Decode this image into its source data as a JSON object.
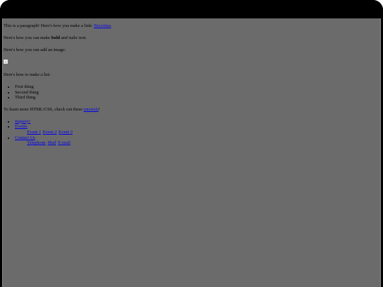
{
  "page": {
    "p1_text": "This is a paragraph! Here's how you make a link: ",
    "p1_link": "Neocities",
    "p1_end": ".",
    "p2_before": "Here's how you can make ",
    "p2_bold": "bold",
    "p2_middle": " and ",
    "p2_italic": "italic",
    "p2_end": " text.",
    "p3_text": "Here's how you can add an image:",
    "p4_text": "Here's how to make a list:",
    "list_items": [
      "First thing",
      "Second thing",
      "Third thing"
    ],
    "p5_text": "To learn more HTML/CSS, check out these ",
    "p5_link": "tutorials",
    "p5_end": "!"
  },
  "nav": {
    "inquiry": "Inquery!",
    "events": "Events",
    "event_links": [
      "Event 1",
      "Event 2",
      "Event 3"
    ],
    "contact": "Contact Us",
    "contact_links": [
      "Telephone",
      "Mail",
      "E-mail"
    ]
  },
  "colors": {
    "page_background": "#6b6b6b",
    "frame": "#000000",
    "link": "#0000ee"
  }
}
